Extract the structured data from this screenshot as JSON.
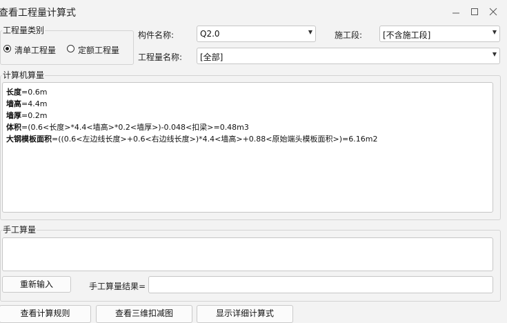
{
  "window": {
    "title": "查看工程量计算式"
  },
  "category": {
    "legend": "工程量类别",
    "options": [
      {
        "label": "清单工程量",
        "checked": true
      },
      {
        "label": "定额工程量",
        "checked": false
      }
    ]
  },
  "fields": {
    "component_label": "构件名称:",
    "component_value": "Q2.0",
    "stage_label": "施工段:",
    "stage_value": "[不含施工段]",
    "quantity_label": "工程量名称:",
    "quantity_value": "[全部]"
  },
  "computer_calc": {
    "legend": "计算机算量",
    "lines": [
      {
        "name": "长度",
        "expr": "=0.6m"
      },
      {
        "name": "墙高",
        "expr": "=4.4m"
      },
      {
        "name": "墙厚",
        "expr": "=0.2m"
      },
      {
        "name": "体积",
        "expr": "=(0.6<长度>*4.4<墙高>*0.2<墙厚>)-0.048<扣梁>=0.48m3"
      },
      {
        "name": "大钢模板面积",
        "expr": "=((0.6<左边线长度>+0.6<右边线长度>)*4.4<墙高>+0.88<原始端头模板面积>)=6.16m2"
      }
    ]
  },
  "manual_calc": {
    "legend": "手工算量",
    "reset_button": "重新输入",
    "result_label": "手工算量结果=",
    "result_value": ""
  },
  "bottom_buttons": {
    "rules": "查看计算规则",
    "view3d": "查看三维扣减图",
    "details": "显示详细计算式"
  }
}
